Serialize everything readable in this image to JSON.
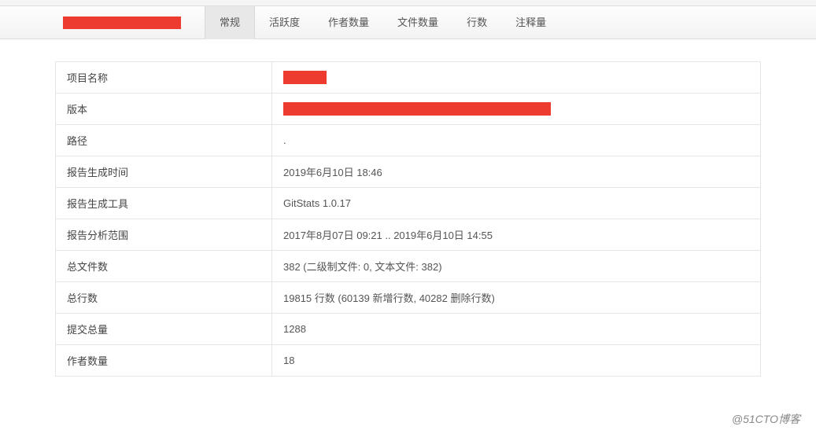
{
  "tabs": [
    {
      "label": "常规",
      "active": true
    },
    {
      "label": "活跃度",
      "active": false
    },
    {
      "label": "作者数量",
      "active": false
    },
    {
      "label": "文件数量",
      "active": false
    },
    {
      "label": "行数",
      "active": false
    },
    {
      "label": "注释量",
      "active": false
    }
  ],
  "rows": [
    {
      "label": "项目名称",
      "value": "",
      "redacted": "small"
    },
    {
      "label": "版本",
      "value": "",
      "redacted": "large"
    },
    {
      "label": "路径",
      "value": "."
    },
    {
      "label": "报告生成时间",
      "value": "2019年6月10日 18:46"
    },
    {
      "label": "报告生成工具",
      "value": "GitStats 1.0.17"
    },
    {
      "label": "报告分析范围",
      "value": "2017年8月07日 09:21 .. 2019年6月10日 14:55"
    },
    {
      "label": "总文件数",
      "value": "382 (二级制文件: 0, 文本文件: 382)"
    },
    {
      "label": "总行数",
      "value": "19815 行数 (60139 新增行数, 40282 删除行数)"
    },
    {
      "label": "提交总量",
      "value": "1288"
    },
    {
      "label": "作者数量",
      "value": "18"
    }
  ],
  "watermark": "@51CTO博客"
}
